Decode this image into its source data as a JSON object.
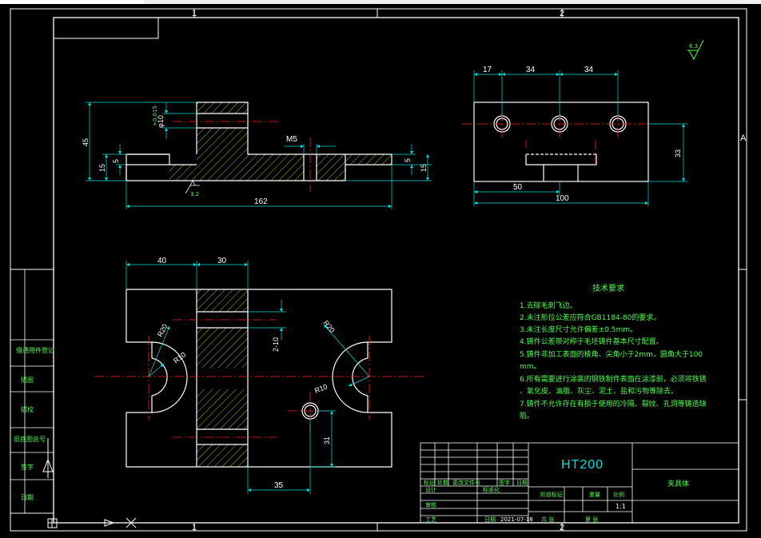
{
  "colors": {
    "background": "#000000",
    "border": "#ffffff",
    "outline": "#ffffff",
    "dimension": "#00e0e0",
    "centerline": "#ff2020",
    "hatch": "#e8e800",
    "note_text": "#4cff4c",
    "title_text": "#00e0e0"
  },
  "zone_labels": {
    "top": [
      "1",
      "2"
    ],
    "bottom": [
      "1",
      "2"
    ],
    "right": [
      "A"
    ]
  },
  "roughness": "6.3",
  "section_view": {
    "dims": {
      "height_total": "45",
      "hole_dia": "φ10",
      "hole_tol": "+0.015",
      "height_left": "15",
      "step_left": "5",
      "thread": "M5",
      "step_right": "5",
      "height_right": "15",
      "length": "162"
    },
    "roughness_mark": "3.2"
  },
  "side_view": {
    "dims": {
      "d1": "17",
      "d2": "34",
      "d3": "34",
      "height": "33",
      "half": "50",
      "width": "100"
    }
  },
  "plan_view": {
    "dims": {
      "w1": "40",
      "w2": "30",
      "r_top": "R20",
      "r_inner": "R10",
      "r_right": "R20",
      "r_right_inner": "R10",
      "holes": "2-10",
      "v31": "31",
      "h35": "35"
    }
  },
  "tech_requirements": {
    "title": "技术要求",
    "items": [
      "1.去除毛刺飞边。",
      "2.未注形位公差应符合GB1184-80的要求。",
      "3.未注长度尺寸允许偏差±0.5mm。",
      "4.铸件公差带对称于毛坯铸件基本尺寸配置。",
      "5.铸件非加工表面的棱角、尖角小于2mm，圆角大于100",
      "mm。",
      "6.所有需要进行涂装的钢铁制件表面在涂漆前，必须将铁锈",
      "、氧化皮、油脂、灰尘、泥土、盐和污物等除去。",
      "7.铸件不允许存在有损于使用的冷隔、裂纹、孔洞等铸造缺",
      "陷。"
    ]
  },
  "title_block": {
    "material": "HT200",
    "part_name": "夹具体",
    "row_labels": [
      "标记",
      "处数",
      "更改文件号",
      "签字",
      "日期"
    ],
    "designer": "设计",
    "standardization": "标准化",
    "checker": "审核",
    "process": "工艺",
    "approve": "日期",
    "date": "2021-07-18",
    "stage_label": "阶段标记",
    "weight_label": "重量",
    "scale_label": "比例",
    "scale": "1:1",
    "sheets_total": "共 张",
    "sheet_no": "第 张"
  },
  "side_strip": {
    "labels": [
      "借通用件登记",
      "描图",
      "描校",
      "旧底图总号",
      "签字",
      "日期"
    ]
  }
}
